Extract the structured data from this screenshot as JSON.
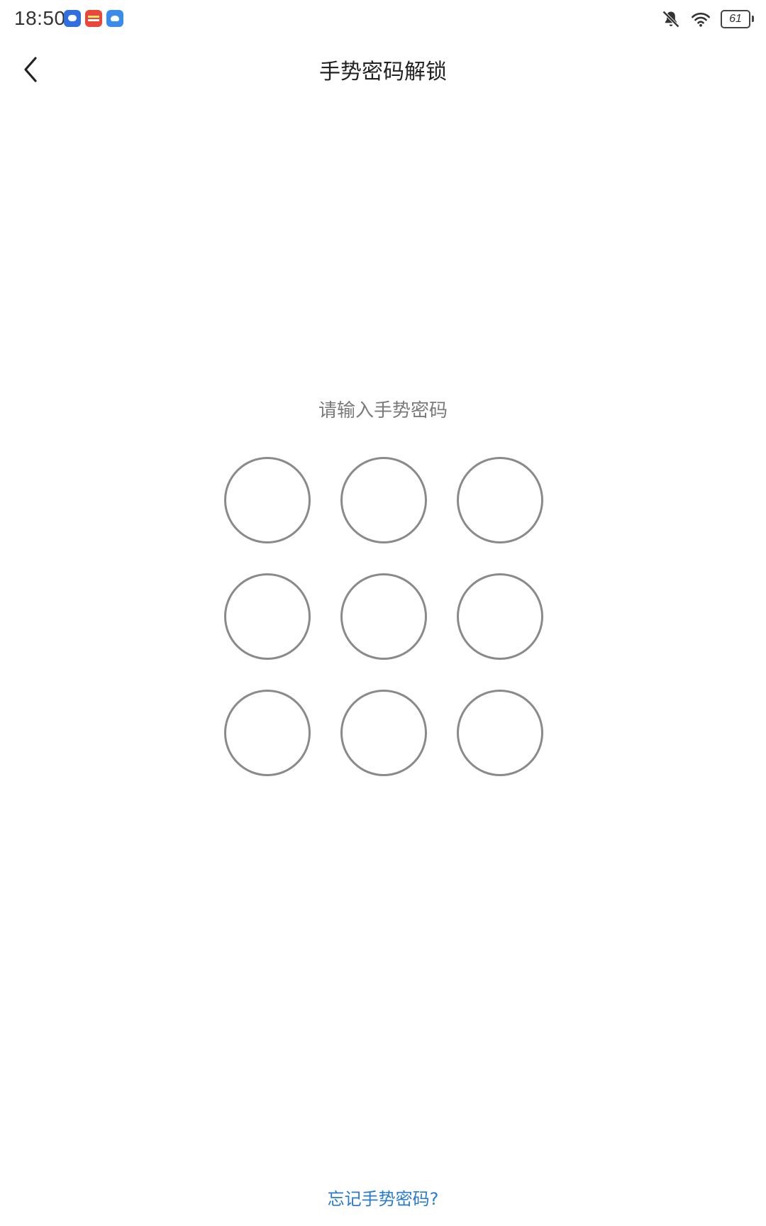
{
  "status_bar": {
    "time": "18:50",
    "notifications": [
      "app-notification-icon",
      "app-notification-icon",
      "app-notification-icon"
    ],
    "battery_level": "61"
  },
  "header": {
    "title": "手势密码解锁"
  },
  "pattern_lock": {
    "prompt": "请输入手势密码",
    "rows": 3,
    "cols": 3,
    "dot_border_color": "#8a8a8a"
  },
  "footer": {
    "forgot_label": "忘记手势密码?",
    "link_color": "#2a7bd0"
  }
}
